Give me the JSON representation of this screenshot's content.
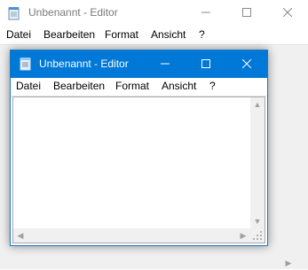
{
  "background_window": {
    "title": "Unbenannt - Editor",
    "menu": [
      {
        "label": "Datei"
      },
      {
        "label": "Bearbeiten"
      },
      {
        "label": "Format"
      },
      {
        "label": "Ansicht"
      },
      {
        "label": "?"
      }
    ]
  },
  "foreground_window": {
    "title": "Unbenannt - Editor",
    "menu": [
      {
        "label": "Datei"
      },
      {
        "label": "Bearbeiten"
      },
      {
        "label": "Format"
      },
      {
        "label": "Ansicht"
      },
      {
        "label": "?"
      }
    ],
    "text_content": ""
  },
  "colors": {
    "active_titlebar": "#0078d7",
    "inactive_title_text": "#7a7a7a",
    "window_border": "#1979ca"
  },
  "icons": [
    "notepad-icon",
    "minimize-icon",
    "maximize-icon",
    "close-icon",
    "scroll-up-arrow-icon",
    "scroll-down-arrow-icon",
    "scroll-left-arrow-icon",
    "scroll-right-arrow-icon",
    "size-grip-icon"
  ]
}
